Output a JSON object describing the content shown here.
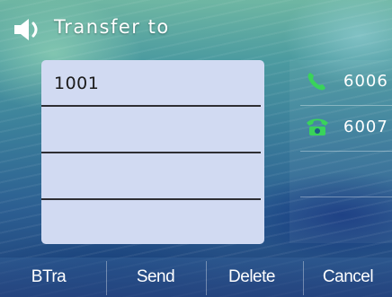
{
  "header": {
    "title": "Transfer to",
    "icon": "speaker-icon"
  },
  "transfer": {
    "entries": [
      "1001",
      "",
      "",
      ""
    ]
  },
  "lines": [
    {
      "label": "6006",
      "icon": "handset-icon",
      "color": "#39d35a"
    },
    {
      "label": "6007",
      "icon": "desk-phone-icon",
      "color": "#39d35a"
    },
    {
      "label": "",
      "icon": ""
    },
    {
      "label": "",
      "icon": ""
    }
  ],
  "softkeys": [
    {
      "label": "BTra"
    },
    {
      "label": "Send"
    },
    {
      "label": "Delete"
    },
    {
      "label": "Cancel"
    }
  ],
  "colors": {
    "panel": "#d1daf2",
    "accent_green": "#39d35a"
  }
}
